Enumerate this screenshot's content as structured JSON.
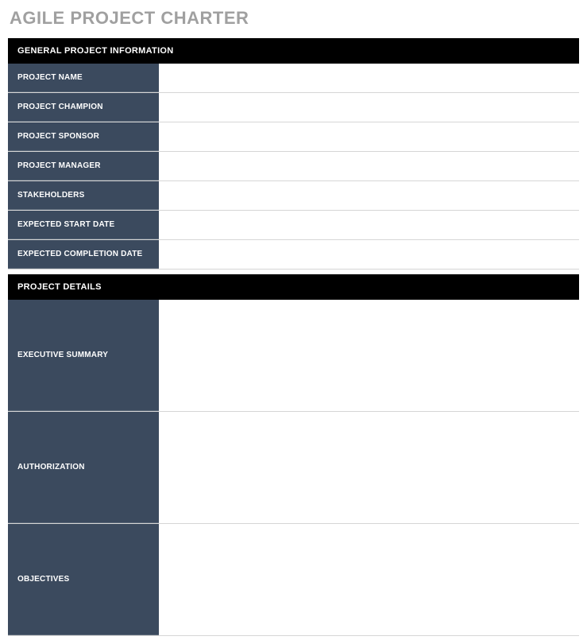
{
  "title": "AGILE PROJECT CHARTER",
  "sections": {
    "general": {
      "header": "GENERAL PROJECT INFORMATION",
      "rows": {
        "project_name": {
          "label": "PROJECT NAME",
          "value": ""
        },
        "project_champion": {
          "label": "PROJECT CHAMPION",
          "value": ""
        },
        "project_sponsor": {
          "label": "PROJECT SPONSOR",
          "value": ""
        },
        "project_manager": {
          "label": "PROJECT MANAGER",
          "value": ""
        },
        "stakeholders": {
          "label": "STAKEHOLDERS",
          "value": ""
        },
        "expected_start_date": {
          "label": "EXPECTED START DATE",
          "value": ""
        },
        "expected_completion_date": {
          "label": "EXPECTED COMPLETION DATE",
          "value": ""
        }
      }
    },
    "details": {
      "header": "PROJECT DETAILS",
      "rows": {
        "executive_summary": {
          "label": "EXECUTIVE SUMMARY",
          "value": ""
        },
        "authorization": {
          "label": "AUTHORIZATION",
          "value": ""
        },
        "objectives": {
          "label": "OBJECTIVES",
          "value": ""
        }
      }
    }
  }
}
